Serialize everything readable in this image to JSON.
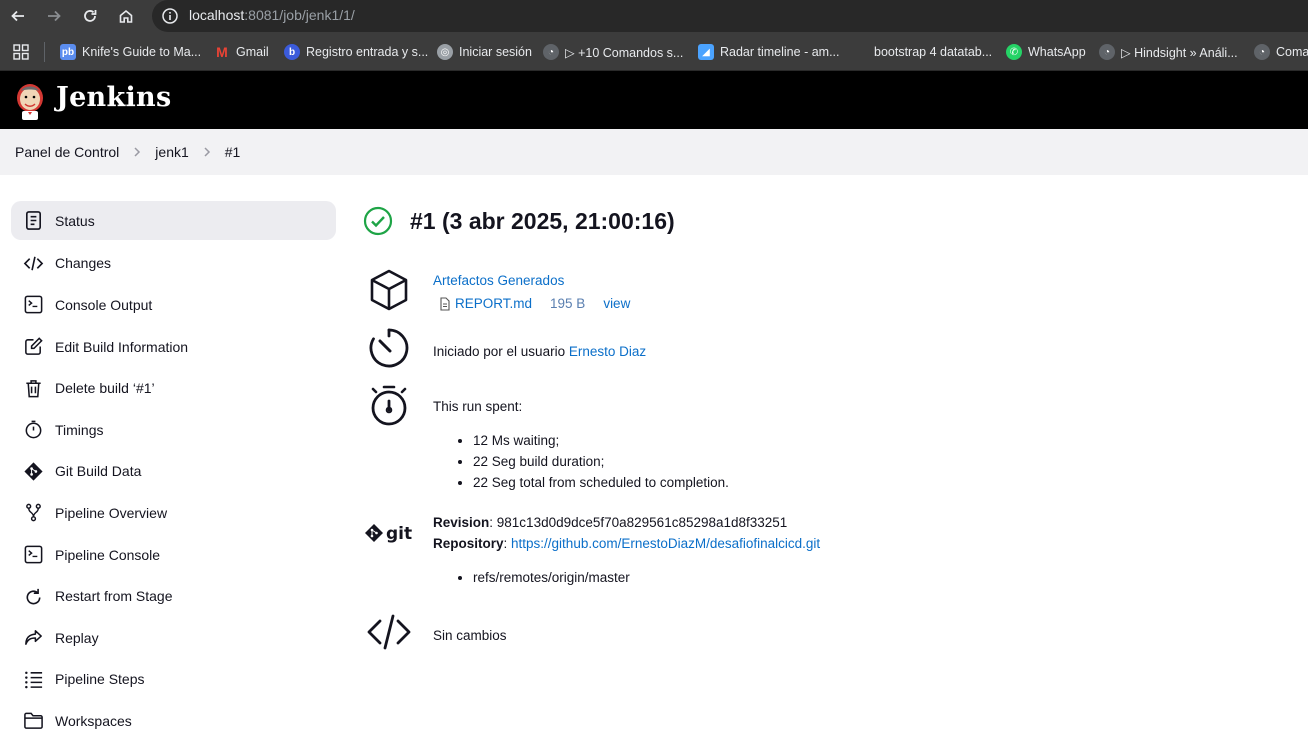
{
  "browser": {
    "url_host": "localhost",
    "url_rest": ":8081/job/jenk1/1/",
    "bookmarks": [
      {
        "label": "Knife's Guide to Ma...",
        "icon": "pb-icon",
        "color": "#5b8def"
      },
      {
        "label": "Gmail",
        "icon": "gmail-icon",
        "color": "#ea4335"
      },
      {
        "label": "Registro entrada y s...",
        "icon": "b-icon",
        "color": "#3b5bdb"
      },
      {
        "label": "Iniciar sesión",
        "icon": "globe-icon",
        "color": "#9aa0a6"
      },
      {
        "label": "▷ +10 Comandos s...",
        "icon": "incognito-icon",
        "color": "#5f6368"
      },
      {
        "label": "Radar timeline - am...",
        "icon": "radar-icon",
        "color": "#4ba3ff"
      },
      {
        "label": "bootstrap 4 datatab...",
        "icon": "none",
        "color": "#3c3c3c"
      },
      {
        "label": "WhatsApp",
        "icon": "whatsapp-icon",
        "color": "#25d366"
      },
      {
        "label": "▷ Hindsight » Análi...",
        "icon": "incognito-icon",
        "color": "#5f6368"
      },
      {
        "label": "Coma",
        "icon": "incognito-icon",
        "color": "#5f6368"
      }
    ]
  },
  "header": {
    "title": "Jenkins"
  },
  "breadcrumb": [
    "Panel de Control",
    "jenk1",
    "#1"
  ],
  "sidebar": {
    "items": [
      {
        "label": "Status",
        "icon": "document-icon"
      },
      {
        "label": "Changes",
        "icon": "code-icon"
      },
      {
        "label": "Console Output",
        "icon": "terminal-icon"
      },
      {
        "label": "Edit Build Information",
        "icon": "edit-icon"
      },
      {
        "label": "Delete build ‘#1’",
        "icon": "trash-icon"
      },
      {
        "label": "Timings",
        "icon": "stopwatch-icon"
      },
      {
        "label": "Git Build Data",
        "icon": "git-icon"
      },
      {
        "label": "Pipeline Overview",
        "icon": "branch-icon"
      },
      {
        "label": "Pipeline Console",
        "icon": "terminal-icon"
      },
      {
        "label": "Restart from Stage",
        "icon": "restart-icon"
      },
      {
        "label": "Replay",
        "icon": "replay-icon"
      },
      {
        "label": "Pipeline Steps",
        "icon": "steps-icon"
      },
      {
        "label": "Workspaces",
        "icon": "folder-icon"
      }
    ]
  },
  "build": {
    "title": "#1 (3 abr 2025, 21:00:16)",
    "status_color": "#1ea446",
    "artifacts_label": "Artefactos Generados",
    "artifact": {
      "name": "REPORT.md",
      "size": "195 B",
      "view": "view"
    },
    "started_by_prefix": "Iniciado por el usuario ",
    "started_by_user": "Ernesto Diaz",
    "timing_heading": "This run spent:",
    "timings": [
      "12 Ms waiting;",
      "22 Seg build duration;",
      "22 Seg total from scheduled to completion."
    ],
    "git": {
      "revision_label": "Revision",
      "revision": ": 981c13d0d9dce5f70a829561c85298a1d8f33251",
      "repository_label": "Repository",
      "repository_sep": ": ",
      "repository_url": "https://github.com/ErnestoDiazM/desafiofinalcicd.git",
      "refs": [
        "refs/remotes/origin/master"
      ]
    },
    "changes_label": "Sin cambios"
  }
}
